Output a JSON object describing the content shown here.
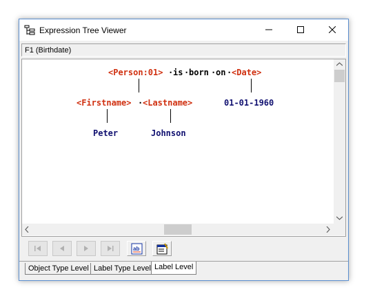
{
  "window": {
    "title": "Expression Tree Viewer",
    "icon": "tree-icon"
  },
  "title_buttons": {
    "minimize": "minimize-icon",
    "maximize": "maximize-icon",
    "close": "close-icon"
  },
  "header": {
    "field_text": "F1 (Birthdate)"
  },
  "tree": {
    "root": {
      "tag1": "<Person:01>",
      "word1": "is",
      "word2": "born",
      "word3": "on",
      "tag2": "<Date>"
    },
    "level2": {
      "tag1": "<Firstname>",
      "tag2": "<Lastname>",
      "value": "01-01-1960"
    },
    "level3": {
      "value1": "Peter",
      "value2": "Johnson"
    },
    "colors": {
      "tag": "#d03010",
      "value": "#101070"
    }
  },
  "toolbar": {
    "buttons": [
      "first-icon",
      "previous-icon",
      "next-icon",
      "last-icon",
      "label-edit-icon",
      "properties-icon"
    ]
  },
  "tabs": [
    {
      "label": "Object Type Level",
      "active": false
    },
    {
      "label": "Label Type Level",
      "active": false
    },
    {
      "label": "Label Level",
      "active": true
    }
  ]
}
